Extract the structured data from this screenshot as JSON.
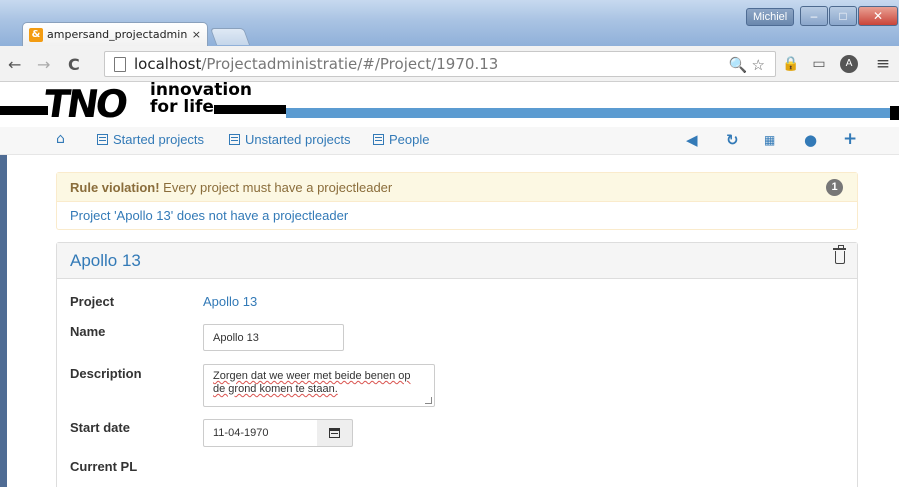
{
  "browser": {
    "tab_title": "ampersand_projectadmini",
    "tab_close": "×",
    "user_name": "Michiel",
    "url_host": "localhost",
    "url_path": "/Projectadministratie/#/Project/1970.13",
    "nav_back": "←",
    "nav_forward": "→",
    "nav_reload": "C",
    "omnibox_icons": "🔍☆",
    "menu_icon": "≡"
  },
  "logo": {
    "word": "TNO",
    "tagline_line1": "innovation",
    "tagline_line2": "for life"
  },
  "navbar": {
    "home_icon": "home-icon",
    "items": [
      {
        "label": "Started projects"
      },
      {
        "label": "Unstarted projects"
      },
      {
        "label": "People"
      }
    ],
    "right_icons": [
      "megaphone-icon",
      "refresh-icon",
      "grid-icon",
      "user-icon",
      "plus-icon"
    ],
    "accent": "#337ab7"
  },
  "alert": {
    "heading_bold": "Rule violation!",
    "heading_text": " Every project must have a projectleader",
    "count": "1",
    "message": "Project 'Apollo 13' does not have a projectleader",
    "colors": {
      "bg": "#fcf8e3",
      "text": "#8a6d3b",
      "border": "#faebcc"
    }
  },
  "panel": {
    "title": "Apollo 13",
    "fields": {
      "project": {
        "label": "Project",
        "value": "Apollo 13"
      },
      "name": {
        "label": "Name",
        "value": "Apollo 13"
      },
      "description": {
        "label": "Description",
        "value": "Zorgen dat we weer met beide benen op de grond komen te staan."
      },
      "start_date": {
        "label": "Start date",
        "value": "11-04-1970"
      },
      "current_pl": {
        "label": "Current PL"
      }
    }
  }
}
